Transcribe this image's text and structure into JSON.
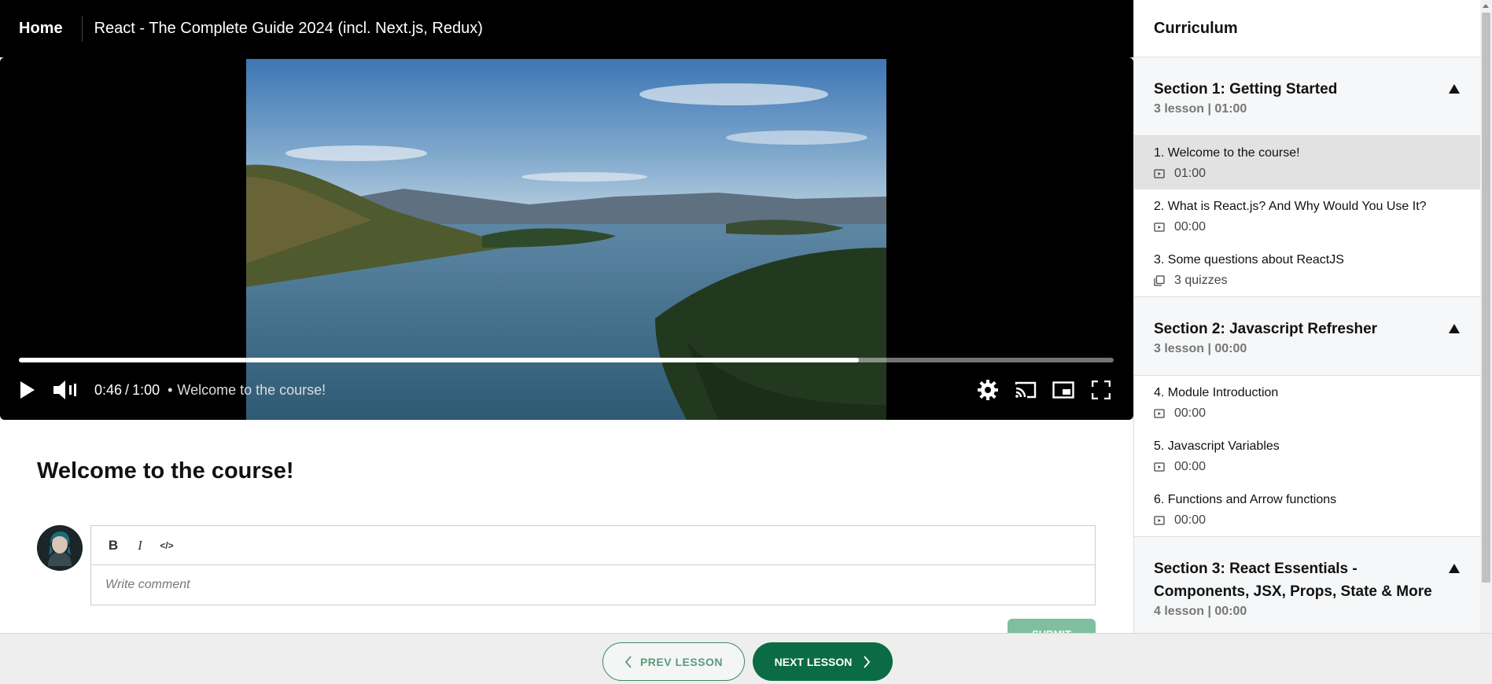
{
  "header": {
    "home_label": "Home",
    "course_title": "React - The Complete Guide 2024 (incl. Next.js, Redux)"
  },
  "player": {
    "current_time": "0:46",
    "separator": "/",
    "duration": "1:00",
    "chapter_dot": "•",
    "chapter_title": "Welcome to the course!",
    "progress": 0.767
  },
  "lesson": {
    "title": "Welcome to the course!",
    "comment_placeholder": "Write comment",
    "bold_label": "B",
    "italic_label": "I",
    "code_label": "</>",
    "submit_label": "SUBMIT"
  },
  "footer": {
    "prev_label": "PREV LESSON",
    "next_label": "NEXT LESSON"
  },
  "sidebar": {
    "title": "Curriculum",
    "sections": [
      {
        "title": "Section 1: Getting Started",
        "meta": "3 lesson | 01:00",
        "lessons": [
          {
            "name": "1. Welcome to the course!",
            "meta": "01:00",
            "icon": "video-icon",
            "active": true
          },
          {
            "name": "2. What is React.js? And Why Would You Use It?",
            "meta": "00:00",
            "icon": "video-icon"
          },
          {
            "name": "3. Some questions about ReactJS",
            "meta": "3 quizzes",
            "icon": "quiz-icon"
          }
        ]
      },
      {
        "title": "Section 2: Javascript Refresher",
        "meta": "3 lesson | 00:00",
        "lessons": [
          {
            "name": "4. Module Introduction",
            "meta": "00:00",
            "icon": "video-icon"
          },
          {
            "name": "5. Javascript Variables",
            "meta": "00:00",
            "icon": "video-icon"
          },
          {
            "name": "6. Functions and Arrow functions",
            "meta": "00:00",
            "icon": "video-icon"
          }
        ]
      },
      {
        "title": "Section 3: React Essentials - Components, JSX, Props, State & More",
        "meta": "4 lesson | 00:00"
      }
    ]
  },
  "colors": {
    "accent": "#0b6b44",
    "header_bg": "#000000",
    "active_lesson_bg": "#e2e2e2"
  }
}
